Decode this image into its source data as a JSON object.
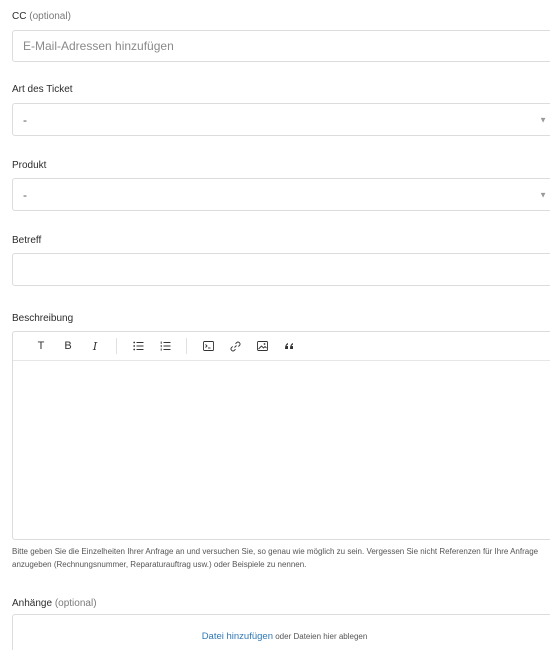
{
  "cc": {
    "label": "CC",
    "optional": "(optional)",
    "placeholder": "E-Mail-Adressen hinzufügen"
  },
  "ticket_type": {
    "label": "Art des Ticket",
    "value": "-"
  },
  "product": {
    "label": "Produkt",
    "value": "-"
  },
  "subject": {
    "label": "Betreff",
    "value": ""
  },
  "description": {
    "label": "Beschreibung",
    "toolbar": {
      "heading": "T",
      "bold": "B",
      "italic": "I"
    },
    "hint": "Bitte geben Sie die Einzelheiten Ihrer Anfrage an und versuchen Sie, so genau wie möglich zu sein. Vergessen Sie nicht Referenzen für Ihre Anfrage anzugeben (Rechnungsnummer, Reparaturauftrag usw.) oder Beispiele zu nennen."
  },
  "attachments": {
    "label": "Anhänge",
    "optional": "(optional)",
    "add_link": "Datei hinzufügen",
    "drop_text": "oder Dateien hier ablegen"
  },
  "colors": {
    "link": "#2f78b7",
    "border": "#dcdcdc"
  },
  "icons": [
    "caret-down-icon",
    "bullet-list-icon",
    "numbered-list-icon",
    "code-icon",
    "link-icon",
    "image-icon",
    "quote-icon"
  ]
}
